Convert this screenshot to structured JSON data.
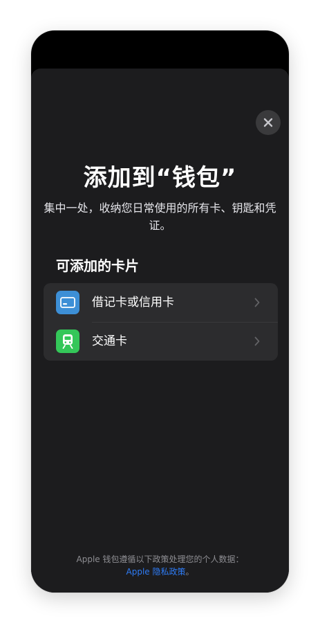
{
  "sheet": {
    "title": "添加到“钱包”",
    "subtitle": "集中一处，收纳您日常使用的所有卡、钥匙和凭证。",
    "close_icon": "close-icon"
  },
  "section": {
    "heading": "可添加的卡片"
  },
  "cards": [
    {
      "label": "借记卡或信用卡",
      "icon": "credit-card-icon",
      "icon_color": "#3d8fd6"
    },
    {
      "label": "交通卡",
      "icon": "train-icon",
      "icon_color": "#34c759"
    }
  ],
  "footer": {
    "text": "Apple 钱包遵循以下政策处理您的个人数据：",
    "link": "Apple 隐私政策",
    "link_suffix": "。",
    "link_color": "#2e7cf6"
  },
  "colors": {
    "background": "#1c1c1e",
    "list_background": "#2c2c2e",
    "text_primary": "#ffffff",
    "text_secondary": "#8e8e93"
  }
}
